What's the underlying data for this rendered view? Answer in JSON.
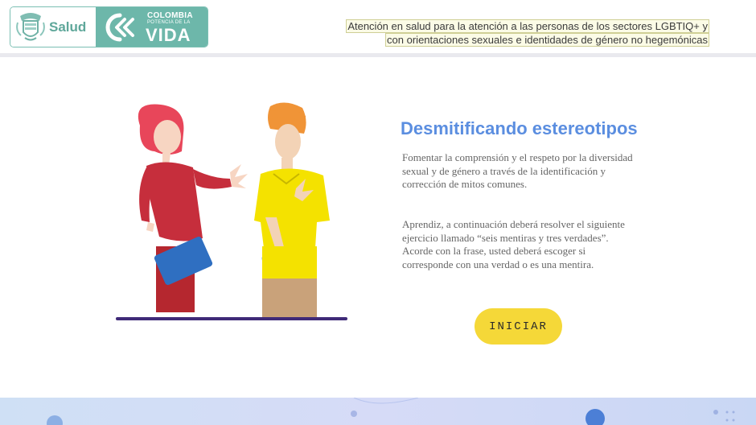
{
  "header": {
    "logo": {
      "ministry": "Salud",
      "slogan_line1": "COLOMBIA",
      "slogan_line2": "POTENCIA DE LA",
      "slogan_line3": "VIDA"
    },
    "tagline_line1": "Atención en salud para la atención a las personas de los sectores LGBTIQ+ y",
    "tagline_line2": "con orientaciones sexuales e identidades de género no hegemónicas"
  },
  "main": {
    "title": "Desmitificando estereotipos",
    "paragraph1": "Fomentar la comprensión y el respeto por la diversidad sexual y de género a través de la identificación y corrección de mitos comunes.",
    "paragraph2": "Aprendiz, a continuación deberá resolver el siguiente ejercicio llamado “seis mentiras y tres verdades”. Acorde con la frase, usted deberá escoger si corresponde con una verdad o es una mentira.",
    "start_button": "INICIAR"
  },
  "colors": {
    "title": "#5b8ee0",
    "button": "#f5d838",
    "logo_teal": "#6db7aa",
    "footer_band": "#d3dcf6"
  }
}
